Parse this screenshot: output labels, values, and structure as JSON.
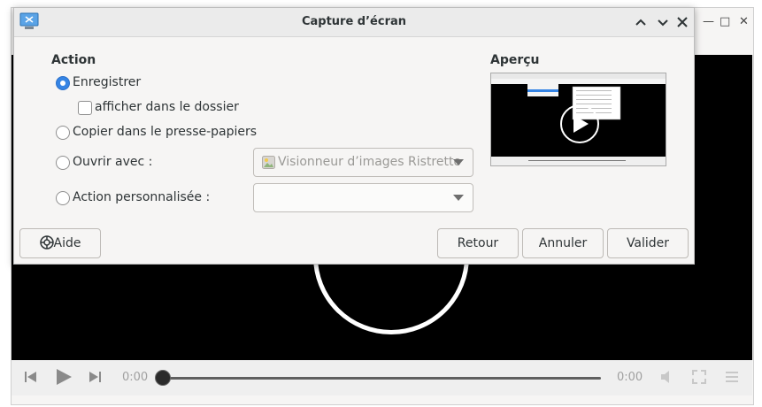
{
  "background_window": {
    "controls": {
      "time_current": "0:00",
      "time_total": "0:00"
    }
  },
  "dialog": {
    "title": "Capture d’écran",
    "action_heading": "Action",
    "preview_heading": "Aperçu",
    "options": {
      "save": "Enregistrer",
      "show_in_folder": "afficher dans le dossier",
      "copy": "Copier dans le presse-papiers",
      "open_with": "Ouvrir avec :",
      "custom": "Action personnalisée :"
    },
    "open_with_app": "Visionneur d’images Ristretto",
    "custom_action_value": "",
    "buttons": {
      "help": "Aide",
      "back": "Retour",
      "cancel": "Annuler",
      "ok": "Valider"
    },
    "state": {
      "selected_option": "save",
      "show_in_folder_checked": false
    }
  },
  "colors": {
    "accent": "#3584e4",
    "video_bg": "#000000"
  }
}
